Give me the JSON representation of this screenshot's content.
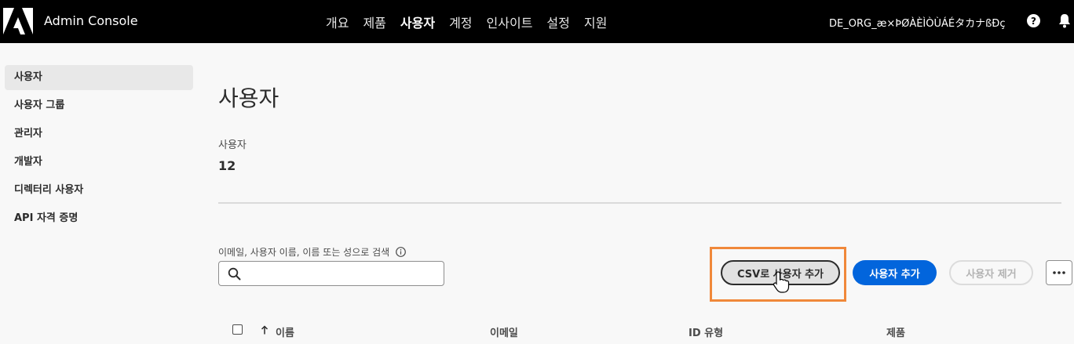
{
  "header": {
    "app_title": "Admin Console",
    "nav": [
      {
        "label": "개요"
      },
      {
        "label": "제품"
      },
      {
        "label": "사용자",
        "active": true
      },
      {
        "label": "계정"
      },
      {
        "label": "인사이트"
      },
      {
        "label": "설정"
      },
      {
        "label": "지원"
      }
    ],
    "org_name": "DE_ORG_æ×ÞØÀÈÌÒÙÁÉタカナßÐç",
    "icons": [
      "adobe-logo",
      "help-icon",
      "bell-icon"
    ]
  },
  "sidebar": {
    "items": [
      {
        "label": "사용자",
        "active": true
      },
      {
        "label": "사용자 그룹"
      },
      {
        "label": "관리자"
      },
      {
        "label": "개발자"
      },
      {
        "label": "디렉터리 사용자"
      },
      {
        "label": "API 자격 증명"
      }
    ]
  },
  "main": {
    "title": "사용자",
    "count_label": "사용자",
    "count_value": "12",
    "search": {
      "label": "이메일, 사용자 이름, 이름 또는 성으로 검색",
      "value": "",
      "placeholder": ""
    },
    "buttons": {
      "add_csv": "CSV로 사용자 추가",
      "add_user": "사용자 추가",
      "remove_user": "사용자 제거"
    },
    "table": {
      "columns": [
        "이름",
        "이메일",
        "ID 유형",
        "제품"
      ],
      "sort_column": "이름",
      "sort_direction": "ascending"
    }
  },
  "colors": {
    "topbar": "#000000",
    "accent": "#0265dc",
    "highlight": "#f0883a",
    "background": "#f8f8f8"
  }
}
